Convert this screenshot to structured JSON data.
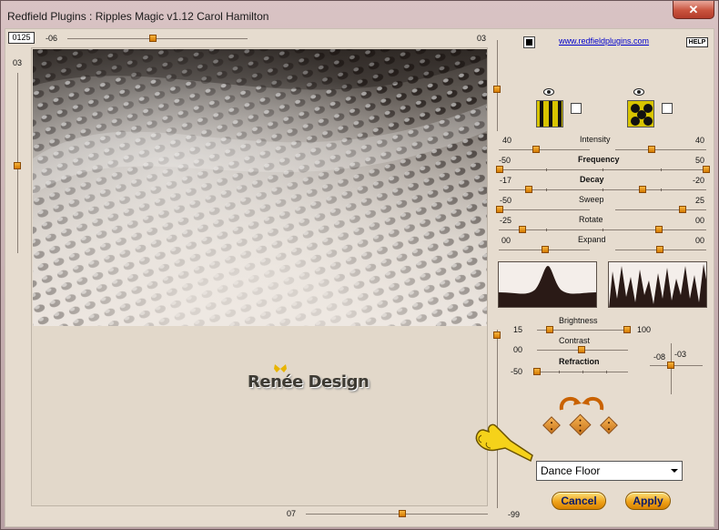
{
  "window": {
    "title": "Redfield Plugins : Ripples Magic v1.12   Carol Hamilton",
    "close_glyph": "✕"
  },
  "top": {
    "counter": "0125",
    "slider_min": "-06",
    "slider_max": "03"
  },
  "left_slider": {
    "value": "03"
  },
  "bottom": {
    "slider_min": "07",
    "slider_max": "-99"
  },
  "preview": {
    "logo_text": "Renée Design"
  },
  "header": {
    "website_link": "www.redfieldplugins.com",
    "help_label": "HELP"
  },
  "params": [
    {
      "label": "Intensity",
      "bold": false,
      "left": "40",
      "right": "40"
    },
    {
      "label": "Frequency",
      "bold": true,
      "left": "-50",
      "right": "50"
    },
    {
      "label": "Decay",
      "bold": true,
      "left": "-17",
      "right": "-20"
    },
    {
      "label": "Sweep",
      "bold": false,
      "left": "-50",
      "right": "25"
    },
    {
      "label": "Rotate",
      "bold": false,
      "left": "-25",
      "right": "00"
    },
    {
      "label": "Expand",
      "bold": false,
      "left": "00",
      "right": "00"
    }
  ],
  "lighting": [
    {
      "label": "Brightness",
      "bold": false,
      "left": "15",
      "right": "100"
    },
    {
      "label": "Contrast",
      "bold": false,
      "left": "00",
      "right": ""
    },
    {
      "label": "Refraction",
      "bold": true,
      "left": "-50",
      "right": ""
    }
  ],
  "light_dir": {
    "x": "-08",
    "y": "-03"
  },
  "preset": {
    "selected": "Dance Floor"
  },
  "buttons": {
    "cancel": "Cancel",
    "apply": "Apply"
  },
  "colors": {
    "accent": "#f0a31a",
    "link": "#0000cc",
    "panel": "#e6dccf"
  }
}
